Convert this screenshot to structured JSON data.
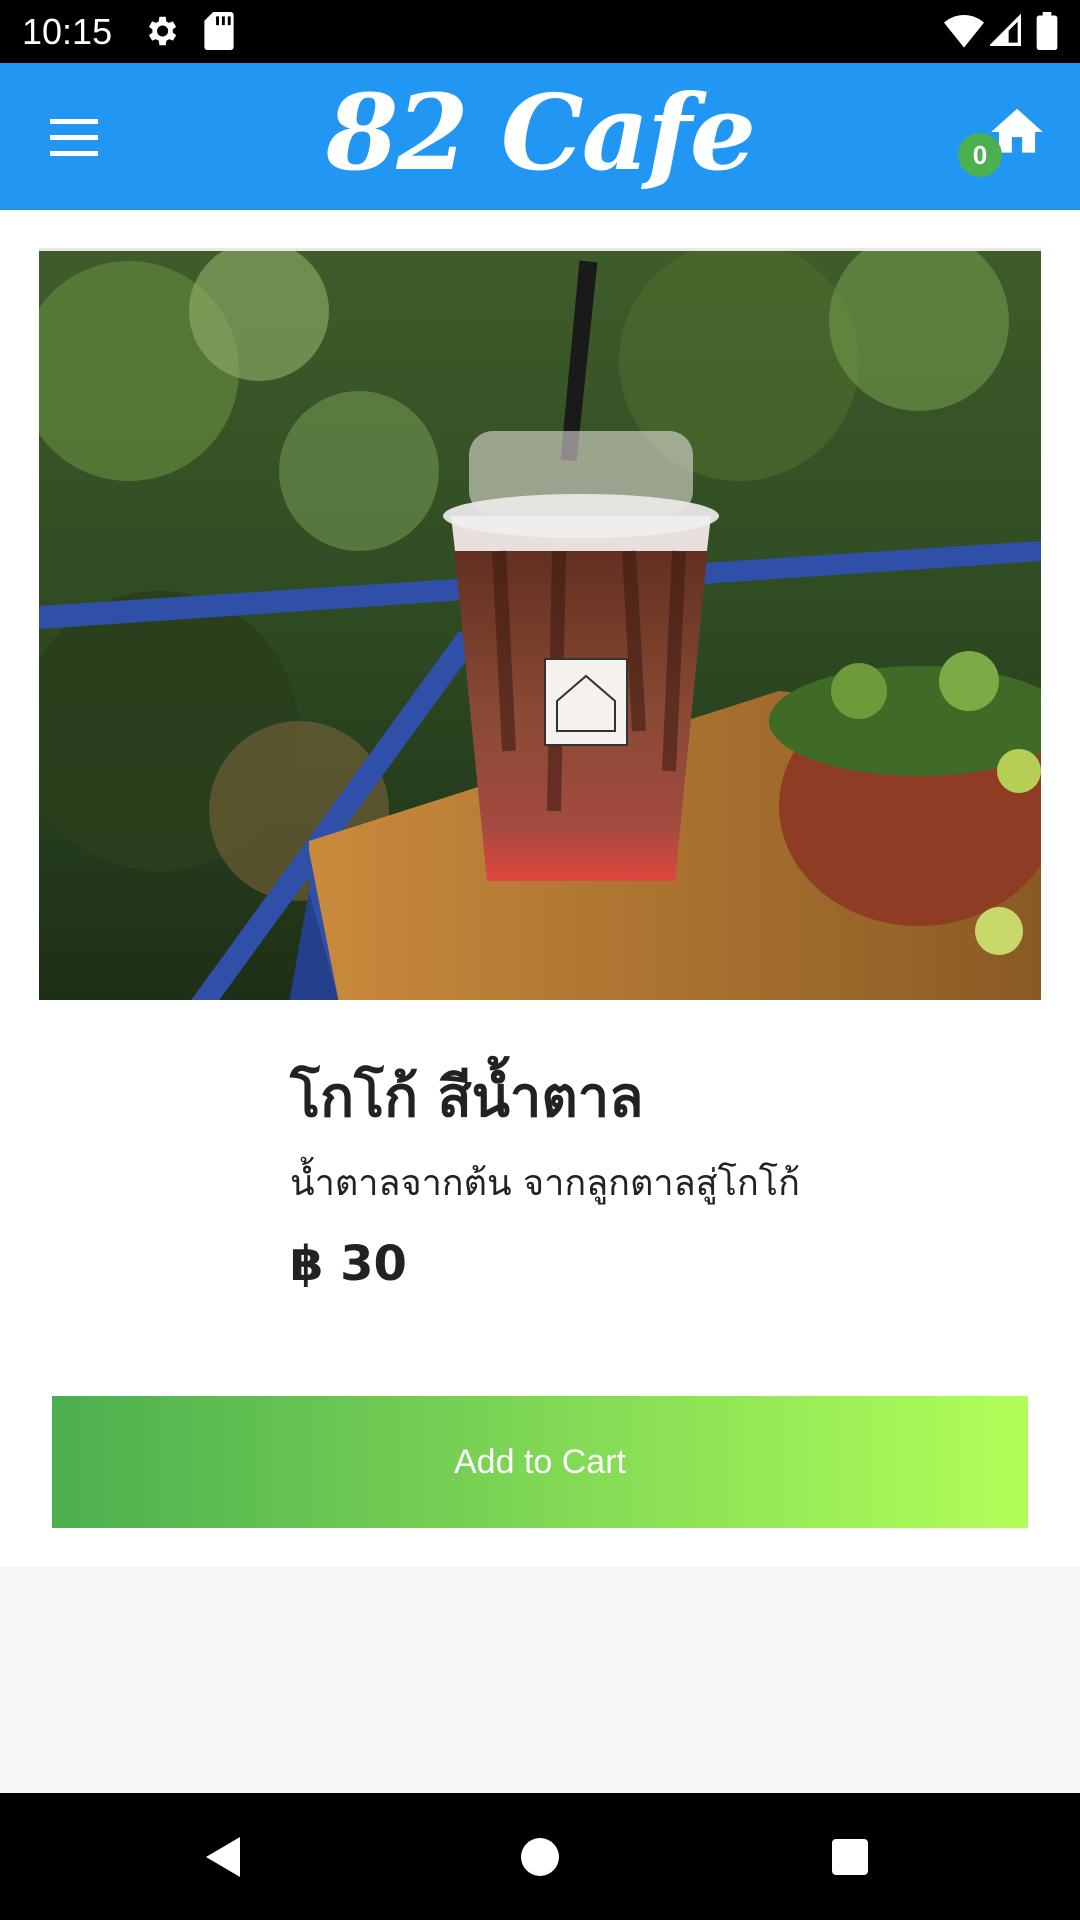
{
  "status_bar": {
    "time": "10:15",
    "icons": [
      "gear-icon",
      "sd-card-icon",
      "wifi-icon",
      "signal-icon",
      "battery-icon"
    ]
  },
  "app_bar": {
    "brand": "82 Cafe",
    "cart_count": "0",
    "menu_icon": "hamburger-menu-icon",
    "home_icon": "home-icon",
    "color": "#2196f3"
  },
  "product": {
    "name": "โกโก้ สีน้ำตาล",
    "description": "น้ำตาลจากต้น จากลูกตาลสู่โกโก้",
    "price": "฿ 30",
    "add_to_cart_label": "Add to Cart",
    "button_gradient": [
      "#4caf50",
      "#b2ff59"
    ]
  },
  "nav_bar": {
    "icons": [
      "back-icon",
      "home-circle-icon",
      "recent-apps-icon"
    ]
  }
}
